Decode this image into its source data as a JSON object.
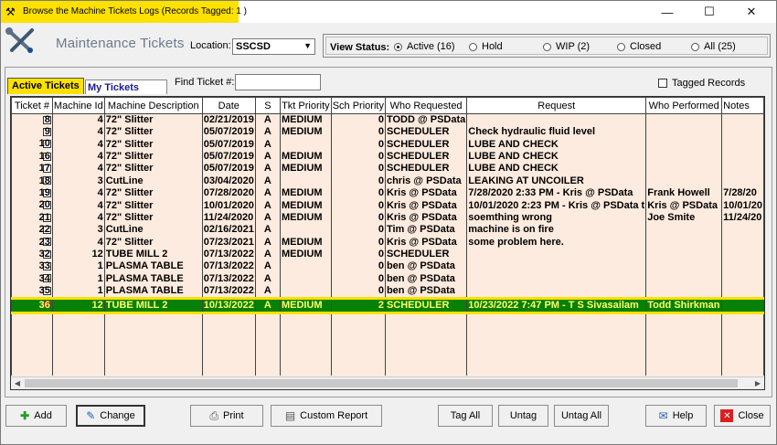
{
  "window": {
    "title": "Browse the Machine Tickets Logs  (Records Tagged:  1 )",
    "controls": {
      "minimize": "—",
      "maximize": "☐",
      "close": "✕"
    }
  },
  "header": {
    "app_title": "Maintenance Tickets",
    "location_label": "Location:",
    "location_value": "SSCSD",
    "view_status_label": "View Status:",
    "view_options": [
      {
        "label": "Active (16)",
        "selected": true
      },
      {
        "label": "Hold",
        "selected": false
      },
      {
        "label": "WIP (2)",
        "selected": false
      },
      {
        "label": "Closed",
        "selected": false
      },
      {
        "label": "All (25)",
        "selected": false
      }
    ]
  },
  "tabs": {
    "active": "Active Tickets",
    "mine": "My Tickets"
  },
  "find": {
    "label": "Find Ticket #:",
    "value": ""
  },
  "tagged": {
    "label": "Tagged Records",
    "checked": false
  },
  "grid": {
    "columns": [
      "Ticket #",
      "Machine Id",
      "Machine Description",
      "Date",
      "S",
      "Tkt Priority",
      "Sch Priority",
      "Who Requested",
      "Request",
      "Who Performed",
      "Notes"
    ],
    "rows": [
      {
        "ticket": "8",
        "machine_id": "4",
        "desc": "72\" Slitter",
        "date": "02/21/2019",
        "s": "A",
        "tkt": "MEDIUM",
        "sch": "0",
        "who": "TODD @ PSData",
        "request": "",
        "performed": "",
        "notes": ""
      },
      {
        "ticket": "9",
        "machine_id": "4",
        "desc": "72\" Slitter",
        "date": "05/07/2019",
        "s": "A",
        "tkt": "MEDIUM",
        "sch": "0",
        "who": "SCHEDULER",
        "request": "Check hydraulic fluid level",
        "performed": "",
        "notes": ""
      },
      {
        "ticket": "10",
        "machine_id": "4",
        "desc": "72\" Slitter",
        "date": "05/07/2019",
        "s": "A",
        "tkt": "",
        "sch": "0",
        "who": "SCHEDULER",
        "request": "LUBE AND CHECK",
        "performed": "",
        "notes": ""
      },
      {
        "ticket": "16",
        "machine_id": "4",
        "desc": "72\" Slitter",
        "date": "05/07/2019",
        "s": "A",
        "tkt": "MEDIUM",
        "sch": "0",
        "who": "SCHEDULER",
        "request": "LUBE AND CHECK",
        "performed": "",
        "notes": ""
      },
      {
        "ticket": "17",
        "machine_id": "4",
        "desc": "72\" Slitter",
        "date": "05/07/2019",
        "s": "A",
        "tkt": "MEDIUM",
        "sch": "0",
        "who": "SCHEDULER",
        "request": "LUBE AND CHECK",
        "performed": "",
        "notes": ""
      },
      {
        "ticket": "18",
        "machine_id": "3",
        "desc": "CutLine",
        "date": "03/04/2020",
        "s": "A",
        "tkt": "",
        "sch": "0",
        "who": "chris @ PSData",
        "request": "LEAKING AT UNCOILER",
        "performed": "",
        "notes": ""
      },
      {
        "ticket": "19",
        "machine_id": "4",
        "desc": "72\" Slitter",
        "date": "07/28/2020",
        "s": "A",
        "tkt": "MEDIUM",
        "sch": "0",
        "who": "Kris @ PSData",
        "request": " 7/28/2020  2:33 PM - Kris @ PSData",
        "performed": "Frank Howell",
        "notes": " 7/28/20"
      },
      {
        "ticket": "20",
        "machine_id": "4",
        "desc": "72\" Slitter",
        "date": "10/01/2020",
        "s": "A",
        "tkt": "MEDIUM",
        "sch": "0",
        "who": "Kris @ PSData",
        "request": "10/01/2020  2:23 PM - Kris @ PSData t",
        "performed": "Kris @ PSData",
        "notes": "10/01/20"
      },
      {
        "ticket": "21",
        "machine_id": "4",
        "desc": "72\" Slitter",
        "date": "11/24/2020",
        "s": "A",
        "tkt": "MEDIUM",
        "sch": "0",
        "who": "Kris @ PSData",
        "request": "soemthing wrong",
        "performed": "Joe Smite",
        "notes": "11/24/20"
      },
      {
        "ticket": "22",
        "machine_id": "3",
        "desc": "CutLine",
        "date": "02/16/2021",
        "s": "A",
        "tkt": "",
        "sch": "0",
        "who": "Tim @ PSData",
        "request": "machine is on fire",
        "performed": "",
        "notes": ""
      },
      {
        "ticket": "23",
        "machine_id": "4",
        "desc": "72\" Slitter",
        "date": "07/23/2021",
        "s": "A",
        "tkt": "MEDIUM",
        "sch": "0",
        "who": "Kris @ PSData",
        "request": "some problem here.",
        "performed": "",
        "notes": ""
      },
      {
        "ticket": "32",
        "machine_id": "12",
        "desc": "TUBE MILL 2",
        "date": "07/13/2022",
        "s": "A",
        "tkt": "MEDIUM",
        "sch": "0",
        "who": "SCHEDULER",
        "request": "",
        "performed": "",
        "notes": ""
      },
      {
        "ticket": "33",
        "machine_id": "1",
        "desc": "PLASMA TABLE",
        "date": "07/13/2022",
        "s": "A",
        "tkt": "",
        "sch": "0",
        "who": "ben @ PSData",
        "request": "",
        "performed": "",
        "notes": ""
      },
      {
        "ticket": "34",
        "machine_id": "1",
        "desc": "PLASMA TABLE",
        "date": "07/13/2022",
        "s": "A",
        "tkt": "",
        "sch": "0",
        "who": "ben @ PSData",
        "request": "",
        "performed": "",
        "notes": ""
      },
      {
        "ticket": "35",
        "machine_id": "1",
        "desc": "PLASMA TABLE",
        "date": "07/13/2022",
        "s": "A",
        "tkt": "",
        "sch": "0",
        "who": "ben @ PSData",
        "request": "",
        "performed": "",
        "notes": ""
      }
    ],
    "selected_row": {
      "ticket": "36",
      "machine_id": "12",
      "desc": "TUBE MILL 2",
      "date": "10/13/2022",
      "s": "A",
      "tkt": "MEDIUM",
      "sch": "2",
      "who": "SCHEDULER",
      "request": "10/23/2022  7:47 PM - T S Sivasailam",
      "performed": "Todd Shirkman",
      "notes": ""
    }
  },
  "buttons": {
    "add": "Add",
    "change": "Change",
    "print": "Print",
    "custom_report": "Custom Report",
    "tag_all": "Tag All",
    "untag": "Untag",
    "untag_all": "Untag All",
    "help": "Help",
    "close": "Close"
  },
  "colors": {
    "highlight_yellow": "#ffe100",
    "grid_bg": "#fdebdf",
    "selected_row_bg": "#078007",
    "selected_row_text": "#ffff66"
  }
}
